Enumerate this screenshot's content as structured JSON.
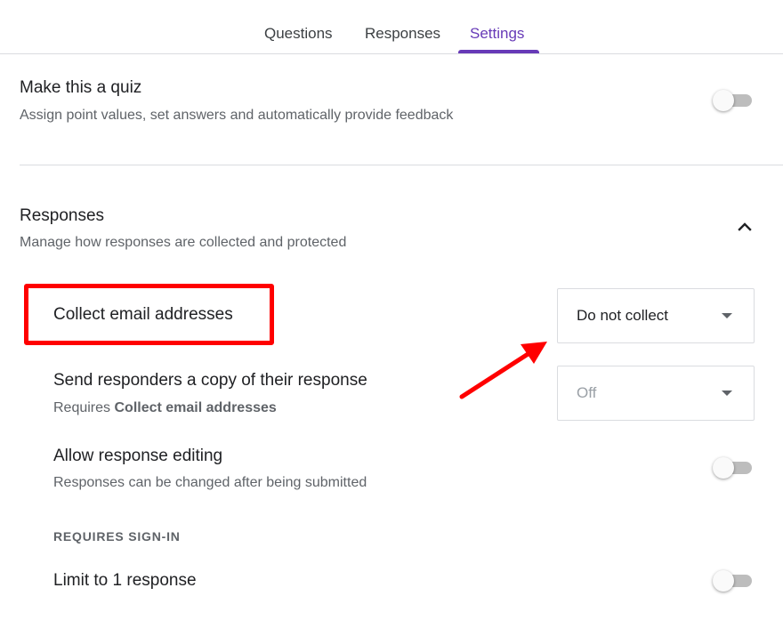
{
  "tabs": [
    {
      "label": "Questions"
    },
    {
      "label": "Responses"
    },
    {
      "label": "Settings"
    }
  ],
  "active_tab": "Settings",
  "accent_color": "#673ab7",
  "quiz": {
    "title": "Make this a quiz",
    "description": "Assign point values, set answers and automatically provide feedback",
    "enabled": false
  },
  "responses_section": {
    "title": "Responses",
    "description": "Manage how responses are collected and protected",
    "expanded": true,
    "collect_email": {
      "label": "Collect email addresses",
      "selected": "Do not collect"
    },
    "send_copy": {
      "label": "Send responders a copy of their response",
      "requires_prefix": "Requires ",
      "requires_bold": "Collect email addresses",
      "selected": "Off"
    },
    "allow_editing": {
      "label": "Allow response editing",
      "description": "Responses can be changed after being submitted",
      "enabled": false
    },
    "requires_signin_header": "REQUIRES SIGN-IN",
    "limit_one": {
      "label": "Limit to 1 response",
      "enabled": false
    }
  },
  "annotation_color": "#ff0000"
}
